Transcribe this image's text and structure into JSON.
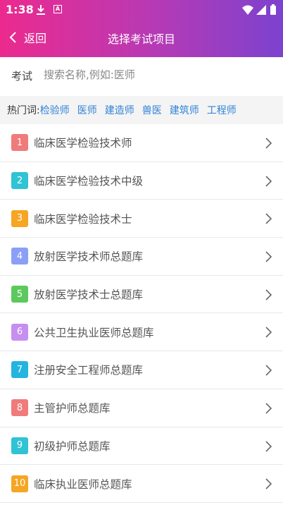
{
  "status": {
    "time": "1:38",
    "icons": [
      "download-icon",
      "a-icon",
      "wifi-icon",
      "signal-icon",
      "battery-icon"
    ]
  },
  "nav": {
    "back_label": "返回",
    "title": "选择考试项目"
  },
  "search": {
    "label": "考试",
    "placeholder": "搜索名称,例如:医师",
    "value": ""
  },
  "hot": {
    "label": "热门词:",
    "tags": [
      "检验师",
      "医师",
      "建造师",
      "兽医",
      "建筑师",
      "工程师"
    ]
  },
  "colors": {
    "header_start": "#ec2a8e",
    "header_end": "#7c42cf",
    "link": "#2f82d6"
  },
  "items": [
    {
      "num": "1",
      "label": "临床医学检验技术师",
      "color": "#f07b7b"
    },
    {
      "num": "2",
      "label": "临床医学检验技术中级",
      "color": "#2fc3d4"
    },
    {
      "num": "3",
      "label": "临床医学检验技术士",
      "color": "#f5a623"
    },
    {
      "num": "4",
      "label": "放射医学技术师总题库",
      "color": "#8a9ff5"
    },
    {
      "num": "5",
      "label": "放射医学技术士总题库",
      "color": "#5cc95e"
    },
    {
      "num": "6",
      "label": "公共卫生执业医师总题库",
      "color": "#c58ef0"
    },
    {
      "num": "7",
      "label": "注册安全工程师总题库",
      "color": "#24b4e0"
    },
    {
      "num": "8",
      "label": "主管护师总题库",
      "color": "#f07b7b"
    },
    {
      "num": "9",
      "label": "初级护师总题库",
      "color": "#2fc3d4"
    },
    {
      "num": "10",
      "label": "临床执业医师总题库",
      "color": "#f5a623"
    }
  ]
}
